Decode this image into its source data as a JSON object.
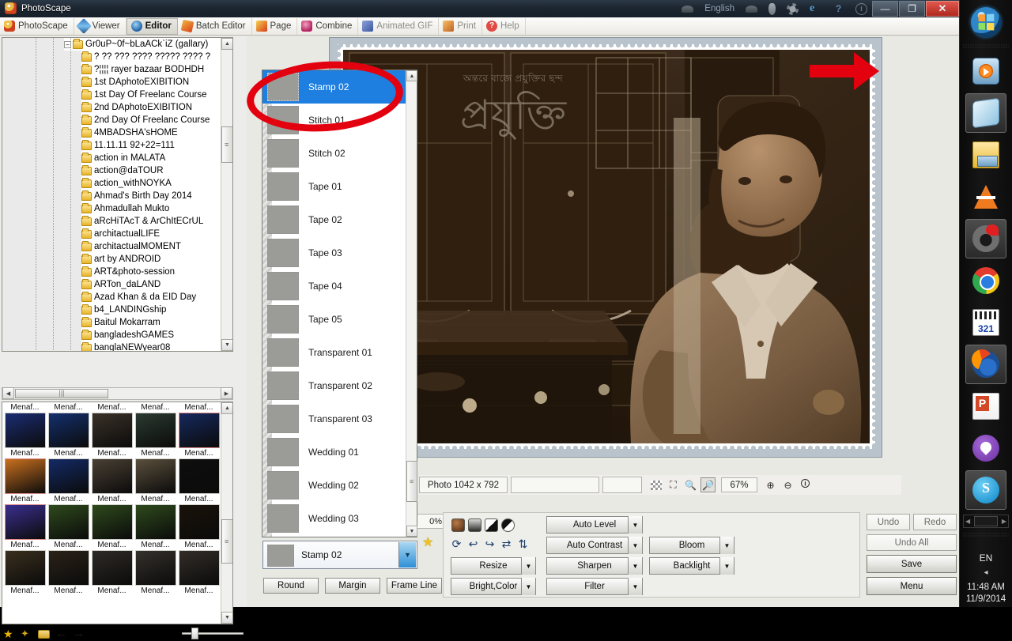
{
  "window": {
    "title": "PhotoScape",
    "language": "English",
    "minimize_label": "—",
    "restore_label": "❐",
    "close_label": "✕",
    "sys_icons": [
      "cloud-icon",
      "plug-icon",
      "gear-icon",
      "internet-explorer-icon",
      "help-icon",
      "info-icon"
    ]
  },
  "module_tabs": [
    {
      "label": "PhotoScape",
      "icon": "photoscape-icon",
      "state": "normal"
    },
    {
      "label": "Viewer",
      "icon": "viewer-icon",
      "state": "normal"
    },
    {
      "label": "Editor",
      "icon": "editor-icon",
      "state": "selected"
    },
    {
      "label": "Batch Editor",
      "icon": "batch-editor-icon",
      "state": "normal"
    },
    {
      "label": "Page",
      "icon": "page-icon",
      "state": "normal"
    },
    {
      "label": "Combine",
      "icon": "combine-icon",
      "state": "normal"
    },
    {
      "label": "Animated GIF",
      "icon": "animated-gif-icon",
      "state": "dim"
    },
    {
      "label": "Print",
      "icon": "print-icon",
      "state": "dim"
    },
    {
      "label": "Help",
      "icon": "help-icon",
      "state": "dim"
    }
  ],
  "folder_tree": {
    "root": "Gr0uP~0f~bLaACk`iZ (gallary)",
    "items": [
      "? ?? ??? ???? ????? ???? ?",
      "?¦¦¦¦ rayer bazaar BODHDH",
      "1st DAphotoEXIBITION",
      "1st Day Of Freelanc Course",
      "2nd DAphotoEXIBITION",
      "2nd Day Of Freelanc Course",
      "4MBADSHA'sHOME",
      "11.11.11 92+22=111",
      "action in MALATA",
      "action@daTOUR",
      "action_withNOYKA",
      "Ahmad's Birth Day 2014",
      "Ahmadullah Mukto",
      "aRcHiTAcT & ArChItECrUL",
      "architactualLIFE",
      "architactualMOMENT",
      "art by ANDROID",
      "ART&photo-session",
      "ARTon_daLAND",
      "Azad Khan & da EID Day",
      "b4_LANDINGship",
      "Baitul Mokarram",
      "bangladeshGAMES",
      "banglaNEWyear08"
    ]
  },
  "thumbnails": {
    "caption": "Menaf...",
    "rows": [
      {
        "captions_above": [
          "Menaf...",
          "Menaf...",
          "Menaf...",
          "Menaf...",
          "Menaf..."
        ]
      }
    ],
    "tiles": [
      {
        "caption": "Menaf...",
        "color": "#1b2d73",
        "selected": false
      },
      {
        "caption": "Menaf...",
        "color": "#14306e",
        "selected": false
      },
      {
        "caption": "Menaf...",
        "color": "#3a3228",
        "selected": false
      },
      {
        "caption": "Menaf...",
        "color": "#2a3a30",
        "selected": false
      },
      {
        "caption": "Menaf...",
        "color": "#16295e",
        "selected": true
      },
      {
        "caption": "Menaf...",
        "color": "#c9701f",
        "selected": true
      },
      {
        "caption": "Menaf...",
        "color": "#132a66",
        "selected": false
      },
      {
        "caption": "Menaf...",
        "color": "#4a4034",
        "selected": false
      },
      {
        "caption": "Menaf...",
        "color": "#5a4f3c",
        "selected": false
      },
      {
        "caption": "Menaf...",
        "color": "#0e0e0e",
        "selected": false
      },
      {
        "caption": "Menaf...",
        "color": "#3a2f8e",
        "selected": true
      },
      {
        "caption": "Menaf...",
        "color": "#2e4a1c",
        "selected": false
      },
      {
        "caption": "Menaf...",
        "color": "#2e4a1c",
        "selected": false
      },
      {
        "caption": "Menaf...",
        "color": "#2e4a1c",
        "selected": false
      },
      {
        "caption": "Menaf...",
        "color": "#1a1209",
        "selected": false
      },
      {
        "caption": "Menaf...",
        "color": "#3a2f1e",
        "selected": false
      },
      {
        "caption": "Menaf...",
        "color": "#2a2218",
        "selected": false
      },
      {
        "caption": "Menaf...",
        "color": "#2f2a26",
        "selected": false
      },
      {
        "caption": "Menaf...",
        "color": "#35302b",
        "selected": false
      },
      {
        "caption": "Menaf...",
        "color": "#332d28",
        "selected": false
      }
    ],
    "toolbar_icons": [
      "favorite-star-icon",
      "batch-star-icon",
      "folder-photo-icon",
      "previous-arrow-icon",
      "next-arrow-icon"
    ],
    "size_slider_value": "small"
  },
  "frame_list": {
    "items": [
      {
        "label": "Stamp 02",
        "selected": true
      },
      {
        "label": "Stitch 01",
        "selected": false
      },
      {
        "label": "Stitch 02",
        "selected": false
      },
      {
        "label": "Tape 01",
        "selected": false
      },
      {
        "label": "Tape 02",
        "selected": false
      },
      {
        "label": "Tape 03",
        "selected": false
      },
      {
        "label": "Tape 04",
        "selected": false
      },
      {
        "label": "Tape 05",
        "selected": false
      },
      {
        "label": "Transparent 01",
        "selected": false
      },
      {
        "label": "Transparent 02",
        "selected": false
      },
      {
        "label": "Transparent 03",
        "selected": false
      },
      {
        "label": "Wedding 01",
        "selected": false
      },
      {
        "label": "Wedding 02",
        "selected": false
      },
      {
        "label": "Wedding 03",
        "selected": false
      }
    ]
  },
  "frame_combo": {
    "selected": "Stamp 02",
    "dropdown_icon": "chevron-down-icon",
    "favorite_icon": "star-icon"
  },
  "frame_buttons": [
    {
      "label": "Round"
    },
    {
      "label": "Margin"
    },
    {
      "label": "Frame Line"
    }
  ],
  "canvas": {
    "watermark_line1": "অন্তরে বাজে প্রযুক্তির ছন্দ",
    "watermark_line2": "প্রযুক্তি",
    "annotation": "red-arrow-annotation",
    "highlight": "red-circle-annotation"
  },
  "status": {
    "photo_info": "Photo 1042 x 792",
    "field2": "",
    "field3": "",
    "zoom_level": "67%",
    "icons": [
      "transparency-icon",
      "fit-screen-icon",
      "actual-size-icon",
      "fit-window-icon",
      "zoom-in-icon",
      "zoom-out-icon",
      "info-icon"
    ],
    "opacity_box": "0%"
  },
  "edit_tools": {
    "tone_swatches": [
      "sepia-tone",
      "grayscale-tone",
      "bw-contrast-tone",
      "invert-tone"
    ],
    "transform_icons": [
      "rotate-icon",
      "rotate-left-icon",
      "rotate-right-icon",
      "flip-horizontal-icon",
      "flip-vertical-icon"
    ],
    "buttons": [
      {
        "label": "Resize",
        "has_dropdown": true
      },
      {
        "label": "Bright,Color",
        "has_dropdown": true
      },
      {
        "label": "Auto Level",
        "has_dropdown": true
      },
      {
        "label": "Auto Contrast",
        "has_dropdown": true
      },
      {
        "label": "Sharpen",
        "has_dropdown": true
      },
      {
        "label": "Filter",
        "has_dropdown": true
      },
      {
        "label": "Bloom",
        "has_dropdown": true
      },
      {
        "label": "Backlight",
        "has_dropdown": true
      }
    ]
  },
  "action_buttons": {
    "undo": "Undo",
    "redo": "Redo",
    "undo_all": "Undo All",
    "save": "Save",
    "menu": "Menu"
  },
  "taskbar": {
    "items": [
      {
        "name": "start-orb-icon",
        "running": false
      },
      {
        "name": "windows-media-player-icon",
        "running": false
      },
      {
        "name": "sticky-notes-icon",
        "running": true
      },
      {
        "name": "file-explorer-icon",
        "running": false
      },
      {
        "name": "vlc-icon",
        "running": false
      },
      {
        "name": "gom-player-icon",
        "running": true
      },
      {
        "name": "google-chrome-icon",
        "running": false
      },
      {
        "name": "k-lite-321-icon",
        "running": false
      },
      {
        "name": "firefox-icon",
        "running": true
      },
      {
        "name": "powerpoint-icon",
        "running": false
      },
      {
        "name": "viber-icon",
        "running": false
      },
      {
        "name": "skype-icon",
        "running": true
      }
    ],
    "language": "EN",
    "time": "11:48 AM",
    "date": "11/9/2014"
  }
}
